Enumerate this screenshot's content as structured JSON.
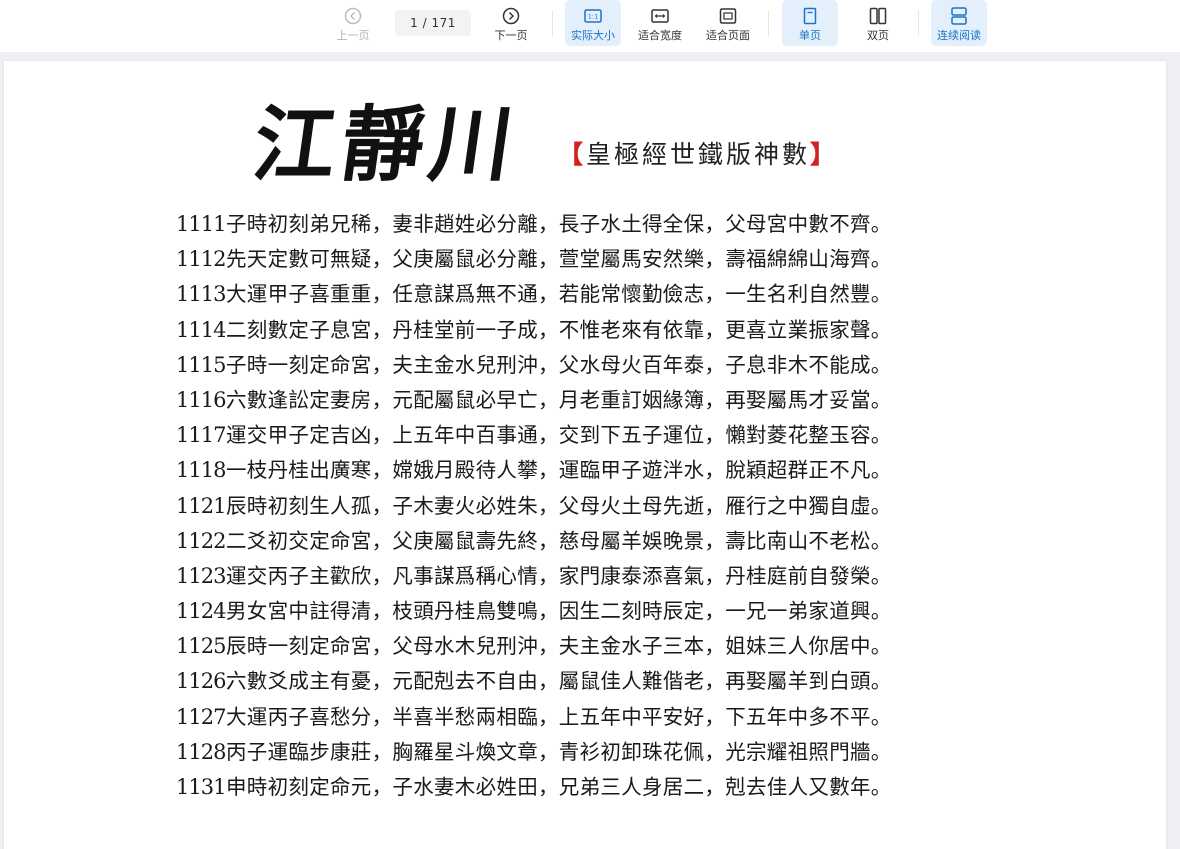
{
  "toolbar": {
    "prev_label": "上一页",
    "next_label": "下一页",
    "current_page": "1",
    "total_pages": "/ 171",
    "actual_size_label": "实际大小",
    "fit_width_label": "适合宽度",
    "fit_page_label": "适合页面",
    "single_page_label": "单页",
    "double_page_label": "双页",
    "continuous_label": "连续阅读",
    "actual_size_icon_text": "1:1",
    "accent_color": "#1a73c8"
  },
  "document": {
    "title_calligraphy": "江靜川",
    "subtitle": "皇極經世鐵版神數",
    "bracket_left": "【",
    "bracket_right": "】",
    "verses": [
      {
        "num": "1111",
        "text": "子時初刻弟兄稀，妻非趙姓必分離，長子水土得全保，父母宮中數不齊。"
      },
      {
        "num": "1112",
        "text": "先天定數可無疑，父庚屬鼠必分離，萱堂屬馬安然樂，壽福綿綿山海齊。"
      },
      {
        "num": "1113",
        "text": "大運甲子喜重重，任意謀爲無不通，若能常懷勤儉志，一生名利自然豐。"
      },
      {
        "num": "1114",
        "text": "二刻數定子息宮，丹桂堂前一子成，不惟老來有依靠，更喜立業振家聲。"
      },
      {
        "num": "1115",
        "text": "子時一刻定命宮，夫主金水兒刑沖，父水母火百年泰，子息非木不能成。"
      },
      {
        "num": "1116",
        "text": "六數逢訟定妻房，元配屬鼠必早亡，月老重訂姻緣簿，再娶屬馬才妥當。"
      },
      {
        "num": "1117",
        "text": "運交甲子定吉凶，上五年中百事通，交到下五子運位，懶對菱花整玉容。"
      },
      {
        "num": "1118",
        "text": "一枝丹桂出廣寒，嫦娥月殿待人攀，運臨甲子遊泮水，脫穎超群正不凡。"
      },
      {
        "num": "1121",
        "text": "辰時初刻生人孤，子木妻火必姓朱，父母火土母先逝，雁行之中獨自虛。"
      },
      {
        "num": "1122",
        "text": "二爻初交定命宮，父庚屬鼠壽先終，慈母屬羊娛晚景，壽比南山不老松。"
      },
      {
        "num": "1123",
        "text": "運交丙子主歡欣，凡事謀爲稱心情，家門康泰添喜氣，丹桂庭前自發榮。"
      },
      {
        "num": "1124",
        "text": "男女宮中註得清，枝頭丹桂鳥雙鳴，因生二刻時辰定，一兄一弟家道興。"
      },
      {
        "num": "1125",
        "text": "辰時一刻定命宮，父母水木兒刑沖，夫主金水子三本，姐妹三人你居中。"
      },
      {
        "num": "1126",
        "text": "六數爻成主有憂，元配剋去不自由，屬鼠佳人難偕老，再娶屬羊到白頭。"
      },
      {
        "num": "1127",
        "text": "大運丙子喜愁分，半喜半愁兩相臨，上五年中平安好，下五年中多不平。"
      },
      {
        "num": "1128",
        "text": "丙子運臨步康莊，胸羅星斗煥文章，青衫初卸珠花佩，光宗耀祖照門牆。"
      },
      {
        "num": "1131",
        "text": "申時初刻定命元，子水妻木必姓田，兄弟三人身居二，剋去佳人又數年。"
      }
    ]
  }
}
